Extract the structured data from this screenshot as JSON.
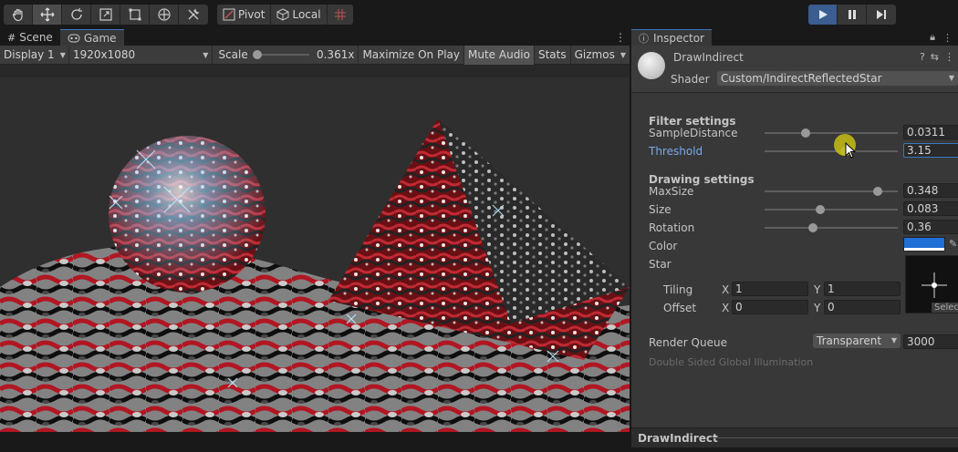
{
  "toolbar": {
    "tools": [
      "hand-tool",
      "move-tool",
      "rotate-tool",
      "scale-tool",
      "rect-tool",
      "transform-tool",
      "custom-tool"
    ],
    "pivot_label": "Pivot",
    "local_label": "Local"
  },
  "game_panel": {
    "tabs": [
      {
        "label": "Scene",
        "icon": "grid-icon"
      },
      {
        "label": "Game",
        "icon": "gamepad-icon"
      }
    ],
    "display": "Display 1",
    "resolution": "1920x1080",
    "scale_label": "Scale",
    "scale_value": "0.361x",
    "scale_level": 0.02,
    "maximize_on_play": "Maximize On Play",
    "mute_audio": "Mute Audio",
    "stats": "Stats",
    "gizmos": "Gizmos"
  },
  "inspector": {
    "tab_label": "Inspector",
    "material_name": "DrawIndirect",
    "shader_label": "Shader",
    "shader_value": "Custom/IndirectReflectedStar",
    "filter_settings": "Filter settings",
    "sample_distance_label": "SampleDistance",
    "sample_distance_value": "0.0311",
    "sample_distance_level": 0.31,
    "threshold_label": "Threshold",
    "threshold_value": "3.15",
    "threshold_level": 0.6,
    "drawing_settings": "Drawing settings",
    "max_size_label": "MaxSize",
    "max_size_value": "0.348",
    "max_size_level": 0.85,
    "size_label": "Size",
    "size_value": "0.083",
    "size_level": 0.42,
    "rotation_label": "Rotation",
    "rotation_value": "0.36",
    "rotation_level": 0.36,
    "color_label": "Color",
    "color_value": "#1f6fd6",
    "star_label": "Star",
    "tiling_label": "Tiling",
    "tiling_x": "1",
    "tiling_y": "1",
    "offset_label": "Offset",
    "offset_x": "0",
    "offset_y": "0",
    "x_label": "X",
    "y_label": "Y",
    "texture_select": "Select",
    "render_queue_label": "Render Queue",
    "render_queue_mode": "Transparent",
    "render_queue_value": "3000",
    "double_sided_gi": "Double Sided Global Illumination",
    "footer_label": "DrawIndirect"
  },
  "colors": {
    "accent": "#3a79bb",
    "play_active": "#3b5d8f",
    "threshold_label": "#7ba8e8",
    "cursor_highlight": "#c8be14"
  }
}
